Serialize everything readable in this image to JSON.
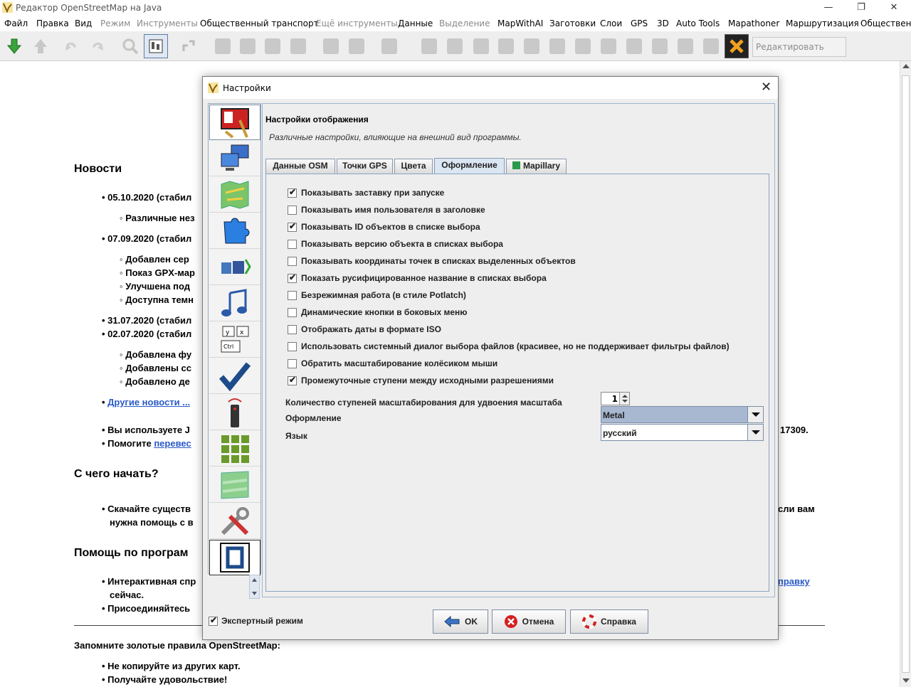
{
  "window": {
    "title": "Редактор OpenStreetMap на Java",
    "min": "—",
    "restore": "❐",
    "close": "✕"
  },
  "menu": [
    {
      "label": "Файл",
      "disabled": false
    },
    {
      "label": "Правка",
      "disabled": false
    },
    {
      "label": "Вид",
      "disabled": false
    },
    {
      "label": "Режим",
      "disabled": true
    },
    {
      "label": "Инструменты",
      "disabled": true
    },
    {
      "label": "Общественный транспорт",
      "disabled": false
    },
    {
      "label": "Ещё инструменты",
      "disabled": true
    },
    {
      "label": "Данные",
      "disabled": false
    },
    {
      "label": "Выделение",
      "disabled": true
    },
    {
      "label": "MapWithAI",
      "disabled": false
    },
    {
      "label": "Заготовки",
      "disabled": false
    },
    {
      "label": "Слои",
      "disabled": false
    },
    {
      "label": "GPS",
      "disabled": false
    },
    {
      "label": "3D",
      "disabled": false
    },
    {
      "label": "Auto Tools",
      "disabled": false
    },
    {
      "label": "Mapathoner",
      "disabled": false
    },
    {
      "label": "Маршрутизация",
      "disabled": false
    },
    {
      "label": "Общественн",
      "disabled": false
    }
  ],
  "toolbar": {
    "edit_tags": "Редактировать теги..."
  },
  "main": {
    "news_heading": "Новости",
    "n1": "05.10.2020 (стабил",
    "n1a": "Различные нез",
    "n2": "07.09.2020 (стабил",
    "n2a": "Добавлен сер",
    "n2b": "Показ GPX-мар",
    "n2c": "Улучшена под",
    "n2d": "Доступна темн",
    "n3": "31.07.2020 (стабил",
    "n4": "02.07.2020 (стабил",
    "n4a": "Добавлена фу",
    "n4b": "Добавлены сс",
    "n4c": "Добавлено де",
    "more_news": "Другие новости ...",
    "using": "Вы используете J",
    "version_tail": "17309.",
    "help_translate": "Помогите",
    "help_translate_link": "перевес",
    "start_heading": "С чего начать?",
    "start1": "Скачайте существ",
    "start1_tail": "сли вам",
    "start2": "нужна помощь с в",
    "helpprog_heading": "Помощь по програм",
    "help1": "Интерактивная спр",
    "help1_link": "правку",
    "help2": "сейчас.",
    "help3": "Присоединяйтесь",
    "golden": "Запомните золотые правила OpenStreetMap:",
    "rule1": "Не копируйте из других карт.",
    "rule2": "Получайте удовольствие!"
  },
  "dialog": {
    "title": "Настройки",
    "panel_title": "Настройки отображения",
    "panel_subtitle": "Различные настройки, влияющие на внешний вид программы.",
    "tabs": [
      "Данные OSM",
      "Точки GPS",
      "Цвета",
      "Оформление",
      "Mapillary"
    ],
    "checkboxes": [
      {
        "label": "Показывать заставку при запуске",
        "checked": true
      },
      {
        "label": "Показывать имя пользователя в заголовке",
        "checked": false
      },
      {
        "label": "Показывать ID объектов в списке выбора",
        "checked": true
      },
      {
        "label": "Показывать версию объекта в списках выбора",
        "checked": false
      },
      {
        "label": "Показывать координаты точек в списках выделенных объектов",
        "checked": false
      },
      {
        "label": "Показать русифицированное название в списках выбора",
        "checked": true
      },
      {
        "label": "Безрежимная работа (в стиле Potlatch)",
        "checked": false
      },
      {
        "label": "Динамические кнопки в боковых меню",
        "checked": false
      },
      {
        "label": "Отображать даты в формате ISO",
        "checked": false
      },
      {
        "label": "Использовать системный диалог выбора файлов (красивее, но не поддерживает фильтры файлов)",
        "checked": false
      },
      {
        "label": "Обратить масштабирование колёсиком мыши",
        "checked": false
      },
      {
        "label": "Промежуточные ступени между исходными разрешениями",
        "checked": true
      }
    ],
    "zoom_steps_label": "Количество ступеней масштабирования для удвоения масштаба",
    "zoom_steps_value": "1",
    "laf_label": "Оформление",
    "laf_value": "Metal",
    "lang_label": "Язык",
    "lang_value": "русский",
    "expert_mode": "Экспертный режим",
    "ok": "OK",
    "cancel": "Отмена",
    "help": "Справка"
  }
}
